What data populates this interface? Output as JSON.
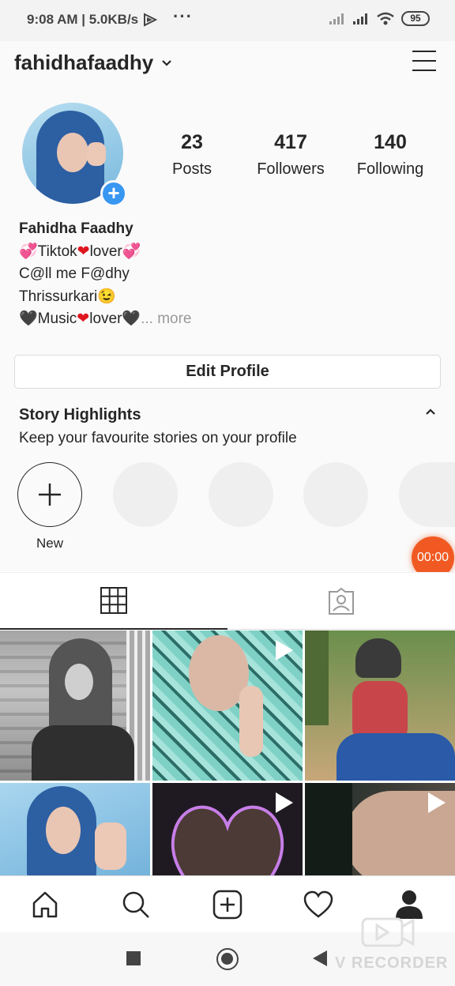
{
  "status_bar": {
    "time_speed": "9:08 AM | 5.0KB/s",
    "dots": "···",
    "battery": "95"
  },
  "header": {
    "username": "fahidhafaadhy"
  },
  "profile": {
    "stats": [
      {
        "value": "23",
        "label": "Posts"
      },
      {
        "value": "417",
        "label": "Followers"
      },
      {
        "value": "140",
        "label": "Following"
      }
    ],
    "full_name": "Fahidha Faadhy",
    "bio_line1": "Tiktok",
    "bio_line1b": "lover",
    "bio_line2": "C@ll me F@dhy",
    "bio_line3": "Thrissurkari",
    "bio_line4": "Music",
    "bio_line4b": "lover",
    "more": "... more",
    "edit_profile": "Edit Profile"
  },
  "highlights": {
    "title": "Story Highlights",
    "subtitle": "Keep your favourite stories on your profile",
    "new_label": "New"
  },
  "recorder": {
    "timer": "00:00",
    "watermark": "V RECORDER"
  },
  "icons": {
    "menu": "menu-icon",
    "grid": "grid-icon",
    "tagged": "tagged-icon",
    "home": "home-icon",
    "search": "search-icon",
    "add": "add-post-icon",
    "activity": "heart-icon",
    "profile": "profile-icon"
  },
  "colors": {
    "accent": "#3897f0",
    "timer": "#f05a22"
  }
}
